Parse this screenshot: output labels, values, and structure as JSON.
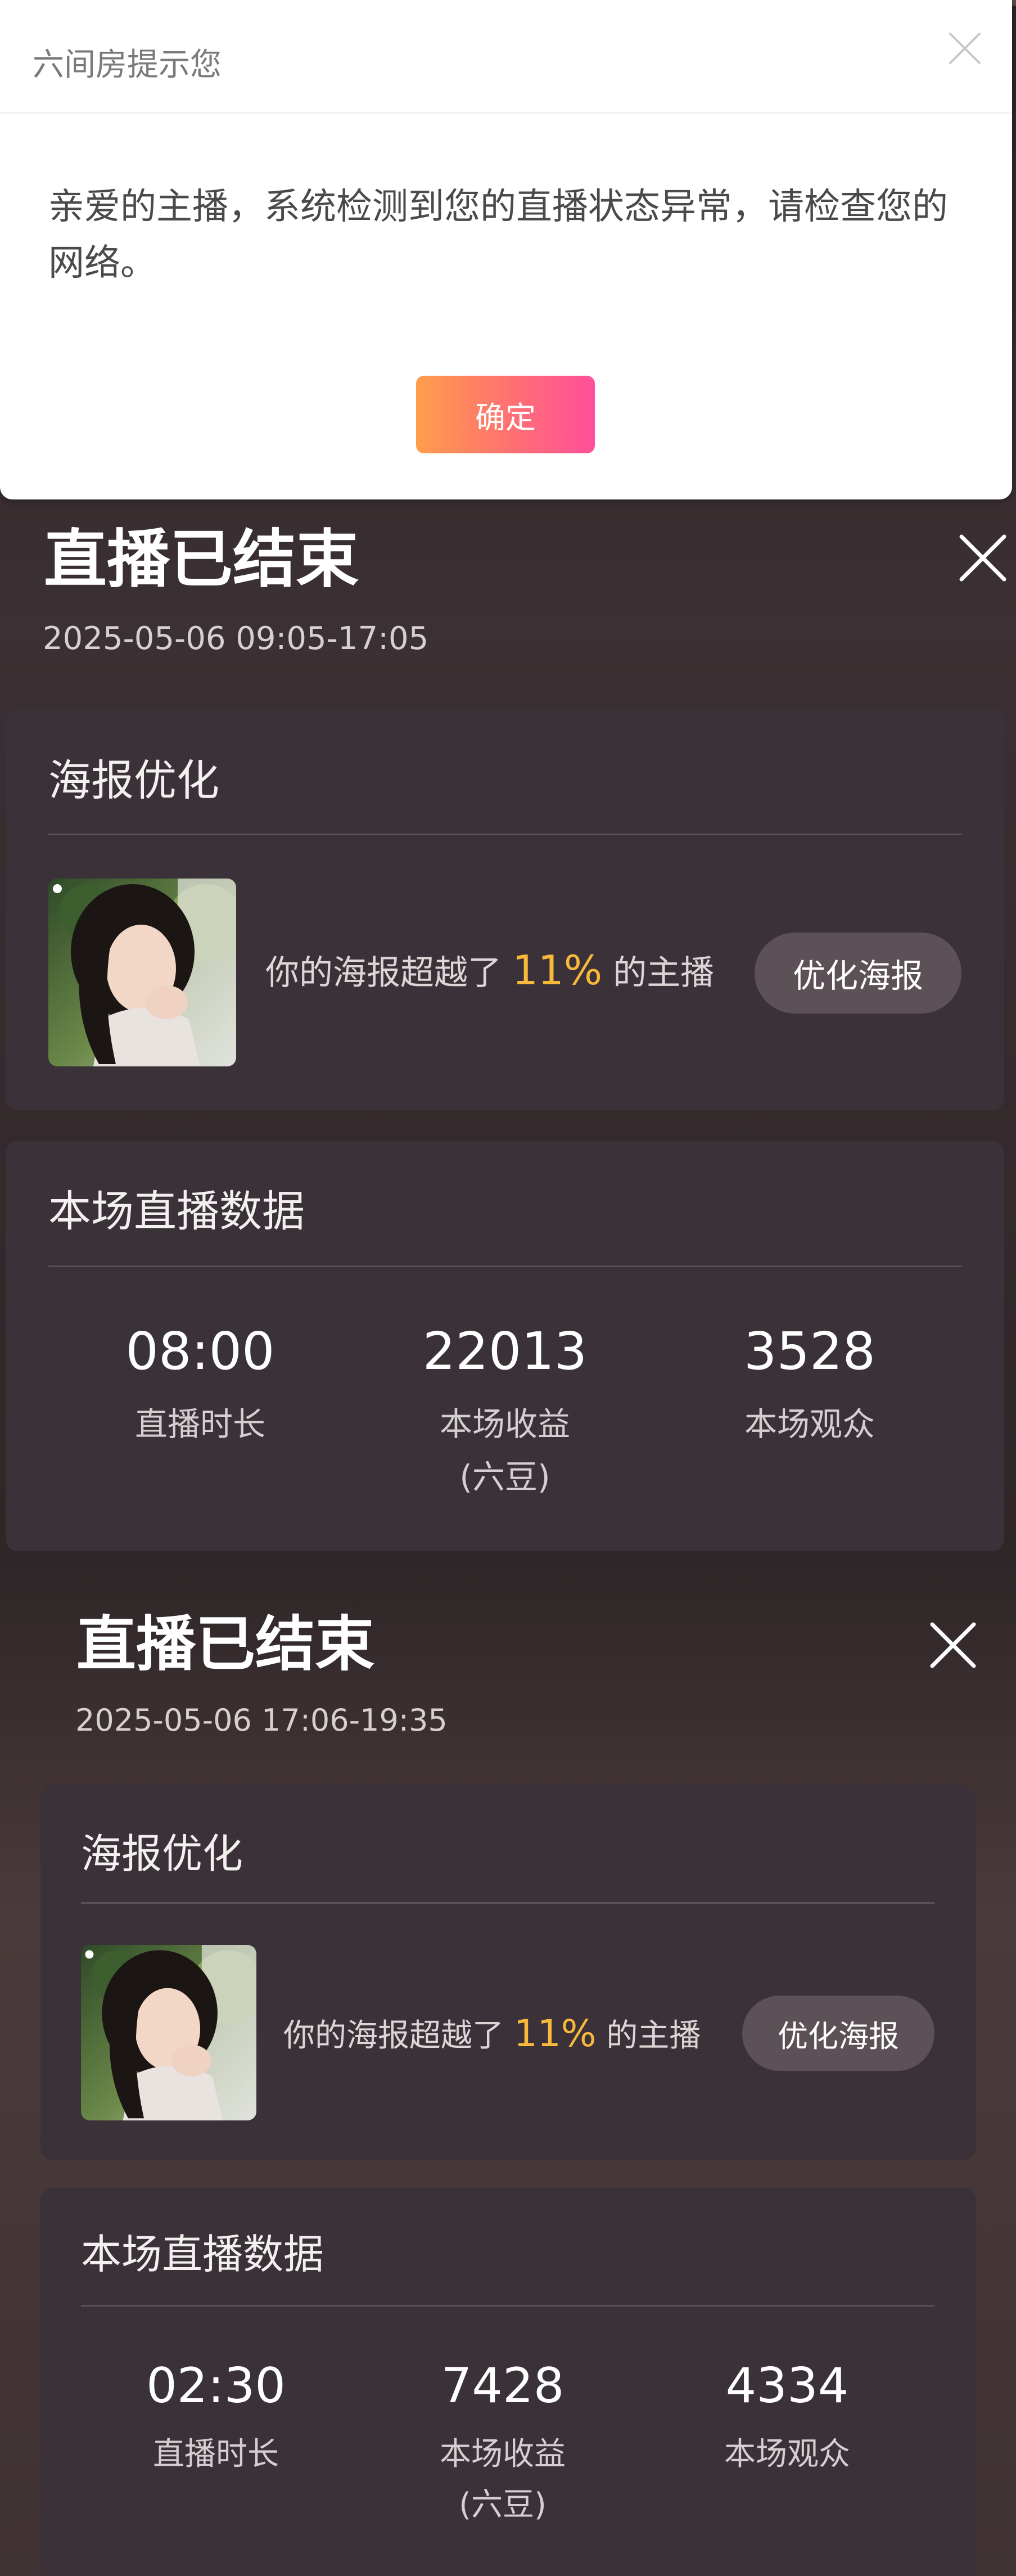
{
  "dialog": {
    "title": "六间房提示您",
    "message": "亲爱的主播，系统检测到您的直播状态异常，请检查您的网络。",
    "confirm_label": "确定"
  },
  "sessions": [
    {
      "title": "直播已结束",
      "time": "2025-05-06 09:05-17:05",
      "poster": {
        "section_title": "海报优化",
        "text_before": "你的海报超越了",
        "percent": "11%",
        "text_after": "的主播",
        "button_label": "优化海报"
      },
      "stats": {
        "section_title": "本场直播数据",
        "duration_value": "08:00",
        "duration_label": "直播时长",
        "income_value": "22013",
        "income_label": "本场收益",
        "income_unit": "(六豆)",
        "audience_value": "3528",
        "audience_label": "本场观众"
      }
    },
    {
      "title": "直播已结束",
      "time": "2025-05-06 17:06-19:35",
      "poster": {
        "section_title": "海报优化",
        "text_before": "你的海报超越了",
        "percent": "11%",
        "text_after": "的主播",
        "button_label": "优化海报"
      },
      "stats": {
        "section_title": "本场直播数据",
        "duration_value": "02:30",
        "duration_label": "直播时长",
        "income_value": "7428",
        "income_label": "本场收益",
        "income_unit": "(六豆)",
        "audience_value": "4334",
        "audience_label": "本场观众"
      }
    }
  ],
  "colors": {
    "accent_percent": "#f7b83b",
    "confirm_gradient_start": "#ff9d4d",
    "confirm_gradient_end": "#ff4f9a"
  }
}
